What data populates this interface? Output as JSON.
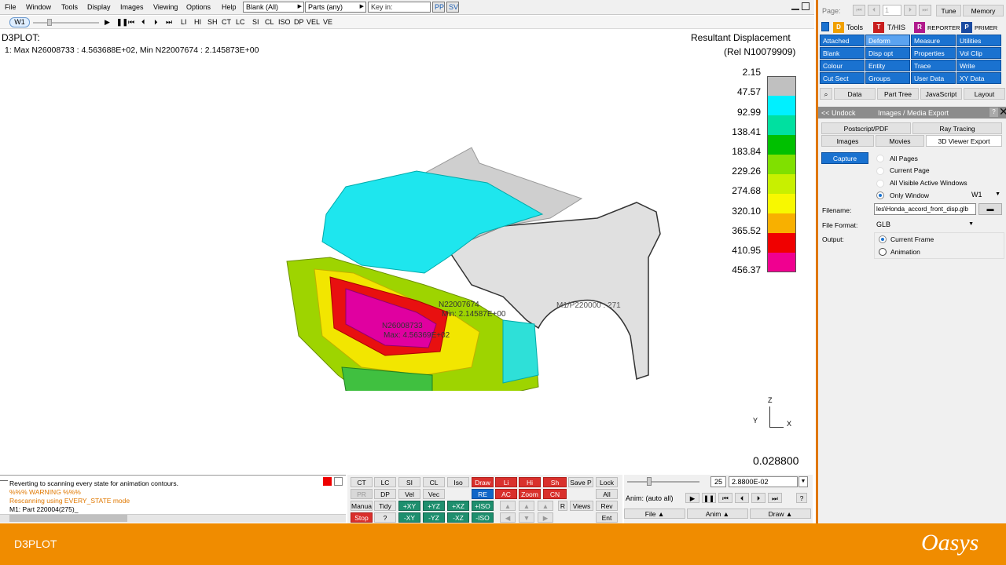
{
  "menu": {
    "items": [
      "File",
      "Window",
      "Tools",
      "Display",
      "Images",
      "Viewing",
      "Options",
      "Help"
    ],
    "blank_combo": "Blank (All)",
    "parts_combo": "Parts (any)",
    "keyin_placeholder": "Key in:",
    "pp": "PP",
    "sv": "SV"
  },
  "toolbar": {
    "window_tab": "W1",
    "modes": [
      "LI",
      "HI",
      "SH",
      "CT",
      "LC",
      "SI",
      "CL",
      "ISO",
      "DP",
      "VEL",
      "VE"
    ]
  },
  "viewport": {
    "title": "D3PLOT:",
    "maxmin": "1: Max N26008733 : 4.563688E+02, Min N22007674 : 2.145873E+00",
    "legend_title": "Resultant Displacement",
    "legend_subtitle": "(Rel N10079909)",
    "legend": [
      {
        "label": "2.15",
        "color": "#c0c0c0"
      },
      {
        "label": "47.57",
        "color": "#00f0ff"
      },
      {
        "label": "92.99",
        "color": "#00e0a0"
      },
      {
        "label": "138.41",
        "color": "#00c000"
      },
      {
        "label": "183.84",
        "color": "#80e000"
      },
      {
        "label": "229.26",
        "color": "#c8f000"
      },
      {
        "label": "274.68",
        "color": "#f8f800"
      },
      {
        "label": "320.10",
        "color": "#f8b000"
      },
      {
        "label": "365.52",
        "color": "#f00000"
      },
      {
        "label": "410.95",
        "color": "#f00090"
      },
      {
        "label": "456.37",
        "color": "#ff00ff"
      }
    ],
    "annotation_min_node": "N22007674",
    "annotation_min_value": "Min: 2.14587E+00",
    "annotation_max_node": "N26008733",
    "annotation_max_value": "Max: 4.56369E+02",
    "part_label": "M1/P220000 : 271",
    "axes": {
      "z": "Z",
      "y": "Y",
      "x": "X"
    },
    "time": "0.028800"
  },
  "messages": [
    {
      "text": "Reverting to scanning every state for animation contours.",
      "color": "#000000"
    },
    {
      "text": "%%% WARNING %%%",
      "color": "#e07800"
    },
    {
      "text": "Rescanning using EVERY_STATE mode",
      "color": "#e07800"
    },
    {
      "text": "M1: Part 220004(275)_",
      "color": "#000000"
    }
  ],
  "controls": {
    "row1": [
      "CT",
      "LC",
      "SI",
      "CL",
      "Iso",
      "Draw",
      "Li",
      "Hi",
      "Sh",
      "Save P",
      "Lock"
    ],
    "row2": [
      "PR",
      "DP",
      "Vel",
      "Vec",
      "RE",
      "AC",
      "Zoom",
      "CN",
      "All"
    ],
    "row3": [
      "Manual",
      "Tidy",
      "+XY",
      "+YZ",
      "+XZ",
      "+ISO",
      "R",
      "Views",
      "Rev"
    ],
    "row4": [
      "Stop",
      "?",
      "-XY",
      "-YZ",
      "-XZ",
      "-ISO",
      "Ent"
    ]
  },
  "anim": {
    "frame": "25",
    "time_value": "2.8800E-02",
    "label": "Anim: (auto all)",
    "help": "?",
    "menus": [
      "File",
      "Anim",
      "Draw"
    ]
  },
  "right": {
    "page_label": "Page:",
    "page_value": "1",
    "tune": "Tune",
    "memory": "Memory",
    "modules": [
      "Tools",
      "T/HIS",
      "REPORTER",
      "PRIMER"
    ],
    "tool_buttons": [
      [
        "Attached",
        "Deform",
        "Measure",
        "Utilities"
      ],
      [
        "Blank",
        "Disp opt",
        "Properties",
        "Vol Clip"
      ],
      [
        "Colour",
        "Entity",
        "Trace",
        "Write"
      ],
      [
        "Cut Sect",
        "Groups",
        "User Data",
        "XY Data"
      ]
    ],
    "tabs": [
      "Data",
      "Part Tree",
      "JavaScript",
      "Layout"
    ],
    "undock": "<< Undock",
    "panel_title": "Images / Media Export",
    "export_tabs": [
      "Postscript/PDF",
      "Ray Tracing",
      "Images",
      "Movies",
      "3D Viewer Export"
    ],
    "capture": "Capture",
    "capture_options": [
      "All Pages",
      "Current Page",
      "All Visible Active Windows",
      "Only Window"
    ],
    "window_choice": "W1",
    "filename_label": "Filename:",
    "filename_value": "les\\Honda_accord_front_disp.glb",
    "format_label": "File Format:",
    "format_value": "GLB",
    "output_label": "Output:",
    "output_options": [
      "Current Frame",
      "Animation"
    ]
  },
  "footer": {
    "app_name": "D3PLOT",
    "brand": "Oasys"
  }
}
